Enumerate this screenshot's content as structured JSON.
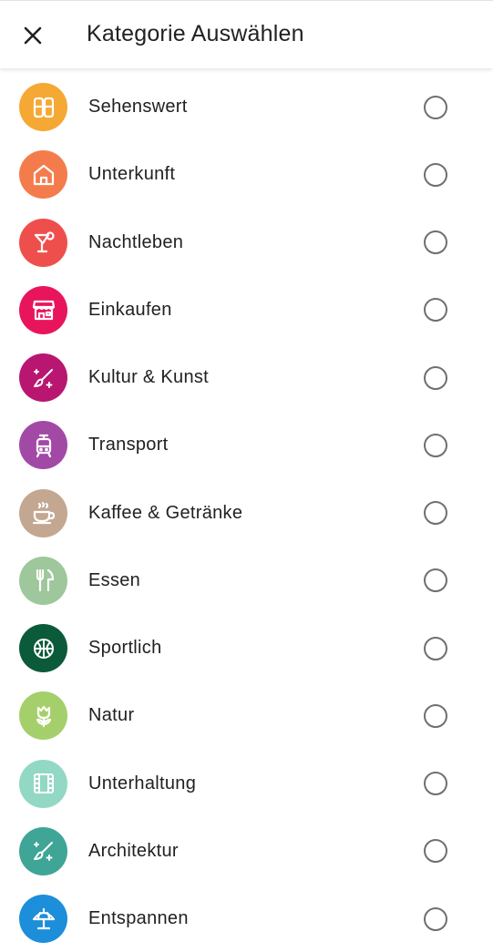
{
  "header": {
    "title": "Kategorie Auswählen"
  },
  "categories": [
    {
      "label": "Sehenswert",
      "icon": "landmark-icon",
      "color": "#f5a833",
      "selected": false
    },
    {
      "label": "Unterkunft",
      "icon": "house-icon",
      "color": "#f47c4c",
      "selected": false
    },
    {
      "label": "Nachtleben",
      "icon": "cocktail-icon",
      "color": "#ef4f4c",
      "selected": false
    },
    {
      "label": "Einkaufen",
      "icon": "store-icon",
      "color": "#e8155d",
      "selected": false
    },
    {
      "label": "Kultur & Kunst",
      "icon": "brush-sparkle-icon",
      "color": "#b81671",
      "selected": false
    },
    {
      "label": "Transport",
      "icon": "tram-icon",
      "color": "#a249a6",
      "selected": false
    },
    {
      "label": "Kaffee & Getränke",
      "icon": "coffee-cup-icon",
      "color": "#c4a791",
      "selected": false
    },
    {
      "label": "Essen",
      "icon": "fork-knife-icon",
      "color": "#9ec79b",
      "selected": false
    },
    {
      "label": "Sportlich",
      "icon": "basketball-icon",
      "color": "#0b5a3a",
      "selected": false
    },
    {
      "label": "Natur",
      "icon": "tulip-icon",
      "color": "#a5cf6a",
      "selected": false
    },
    {
      "label": "Unterhaltung",
      "icon": "film-icon",
      "color": "#92d8c4",
      "selected": false
    },
    {
      "label": "Architektur",
      "icon": "brush-sparkle-icon",
      "color": "#3ea597",
      "selected": false
    },
    {
      "label": "Entspannen",
      "icon": "beach-umbrella-icon",
      "color": "#1d8ed9",
      "selected": false
    }
  ]
}
